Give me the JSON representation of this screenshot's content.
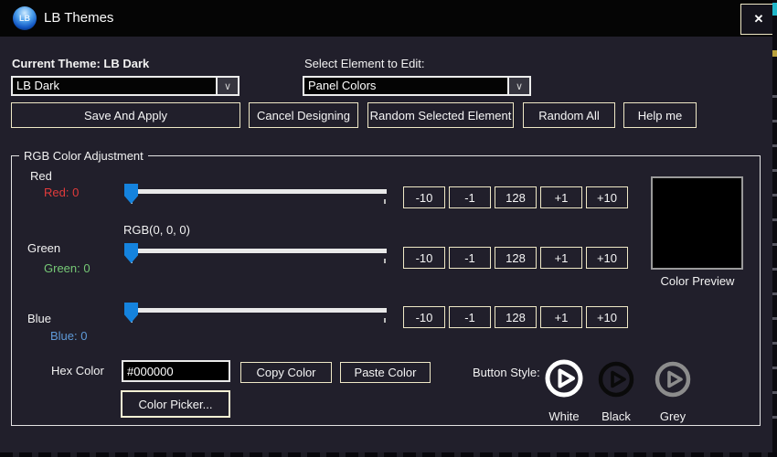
{
  "window": {
    "title": "LB Themes",
    "icon_text": "LB",
    "close_glyph": "✕"
  },
  "theme_section": {
    "current_theme_label": "Current Theme: LB Dark",
    "theme_value": "LB Dark",
    "element_label": "Select Element to Edit:",
    "element_value": "Panel Colors",
    "dropdown_glyph": "∨"
  },
  "toolbar": {
    "save": "Save And Apply",
    "cancel": "Cancel Designing",
    "random_selected": "Random Selected Element",
    "random_all": "Random All",
    "help": "Help me"
  },
  "rgb_group": {
    "title": "RGB Color Adjustment",
    "rgb_value_label": "RGB(0, 0, 0)",
    "channels": [
      {
        "name": "Red",
        "value_label": "Red: 0",
        "value": 0,
        "color": "#e23b3b"
      },
      {
        "name": "Green",
        "value_label": "Green: 0",
        "value": 0,
        "color": "#76c876"
      },
      {
        "name": "Blue",
        "value_label": "Blue: 0",
        "value": 0,
        "color": "#5f9ad8"
      }
    ],
    "step_buttons": [
      "-10",
      "-1",
      "128",
      "+1",
      "+10"
    ],
    "preview_label": "Color Preview",
    "preview_color": "#000000",
    "hex_label": "Hex Color",
    "hex_value": "#000000",
    "copy": "Copy Color",
    "paste": "Paste Color",
    "picker": "Color Picker...",
    "button_style_label": "Button Style:",
    "styles": [
      {
        "label": "White",
        "color": "#ffffff"
      },
      {
        "label": "Black",
        "color": "#0a0a0a"
      },
      {
        "label": "Grey",
        "color": "#8c8c8c"
      }
    ]
  },
  "colors": {
    "window_bg": "#211f2b",
    "titlebar_bg": "#050505",
    "button_border": "#efe8c6",
    "slider_thumb": "#1583de",
    "slider_track": "#e9e9e9"
  }
}
